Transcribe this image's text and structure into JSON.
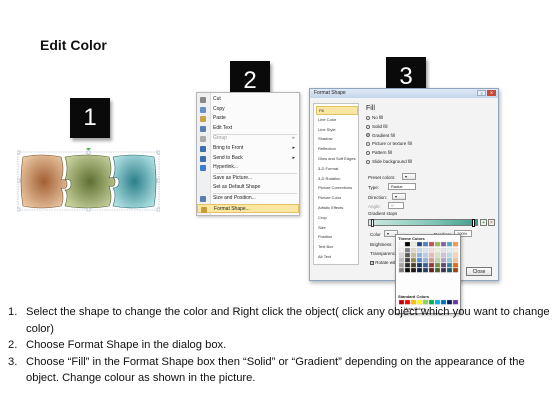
{
  "title": "Edit Color",
  "steps_badges": [
    "1",
    "2",
    "3"
  ],
  "context_menu": {
    "items": [
      {
        "label": "Cut",
        "icon": "scissors-icon",
        "color": "#888888",
        "disabled": false
      },
      {
        "label": "Copy",
        "icon": "copy-icon",
        "color": "#6a8fc7",
        "disabled": false
      },
      {
        "label": "Paste",
        "icon": "paste-icon",
        "color": "#c9a34a",
        "disabled": false
      },
      {
        "label": "Edit Text",
        "icon": "edit-text-icon",
        "color": "#5a7fb3",
        "disabled": false
      },
      {
        "label": "Group",
        "icon": "group-icon",
        "color": "#aaaaaa",
        "disabled": true,
        "submenu": true
      },
      {
        "label": "Bring to Front",
        "icon": "bring-to-front-icon",
        "color": "#3b6fb2",
        "disabled": false,
        "submenu": true
      },
      {
        "label": "Send to Back",
        "icon": "send-to-back-icon",
        "color": "#3b6fb2",
        "disabled": false,
        "submenu": true
      },
      {
        "label": "Hyperlink...",
        "icon": "hyperlink-icon",
        "color": "#3b7bd1",
        "disabled": false
      },
      {
        "label": "Save as Picture...",
        "icon": "",
        "color": "",
        "disabled": false
      },
      {
        "label": "Set as Default Shape",
        "icon": "",
        "color": "",
        "disabled": false
      },
      {
        "label": "Size and Position...",
        "icon": "size-position-icon",
        "color": "#5a7fb3",
        "disabled": false
      },
      {
        "label": "Format Shape...",
        "icon": "format-shape-icon",
        "color": "#c79b3a",
        "disabled": false,
        "selected": true
      }
    ]
  },
  "dialog": {
    "title": "Format Shape",
    "categories": [
      "Fill",
      "Line Color",
      "Line Style",
      "Shadow",
      "Reflection",
      "Glow and Soft Edges",
      "3-D Format",
      "3-D Rotation",
      "Picture Corrections",
      "Picture Color",
      "Artistic Effects",
      "Crop",
      "Size",
      "Position",
      "Text Box",
      "Alt Text"
    ],
    "panel_title": "Fill",
    "fill_options": [
      {
        "label": "No fill",
        "checked": false
      },
      {
        "label": "Solid fill",
        "checked": false
      },
      {
        "label": "Gradient fill",
        "checked": true
      },
      {
        "label": "Picture or texture fill",
        "checked": false
      },
      {
        "label": "Pattern fill",
        "checked": false
      },
      {
        "label": "Slide background fill",
        "checked": false
      }
    ],
    "preset_colors_label": "Preset colors:",
    "type_label": "Type:",
    "type_value": "Radial",
    "direction_label": "Direction:",
    "angle_label": "Angle:",
    "angle_value": "0°",
    "gradient_stops_label": "Gradient stops",
    "color_label": "Color",
    "position_label": "Position:",
    "position_value": "100%",
    "brightness_label": "Brightness:",
    "transparency_label": "Transparency:",
    "rotate_label": "Rotate with shape",
    "close_label": "Close",
    "theme_colors_label": "Theme Colors",
    "standard_colors_label": "Standard Colors",
    "more_colors_label": "More Colors..."
  },
  "instructions": [
    {
      "n": "1.",
      "text": "Select the shape to change the color and Right click the object( click any object which you want to change color)"
    },
    {
      "n": "2.",
      "text": "Choose Format Shape in the dialog box."
    },
    {
      "n": "3.",
      "text": "Choose “Fill” in the Format Shape box then “Solid” or “Gradient” depending on the appearance of the object. Change colour as shown in the picture."
    }
  ],
  "colors": {
    "piece1": "#c9926a",
    "piece2": "#8a9b5c",
    "piece3": "#5aa6ad",
    "highlight": "#fbe7a1"
  }
}
